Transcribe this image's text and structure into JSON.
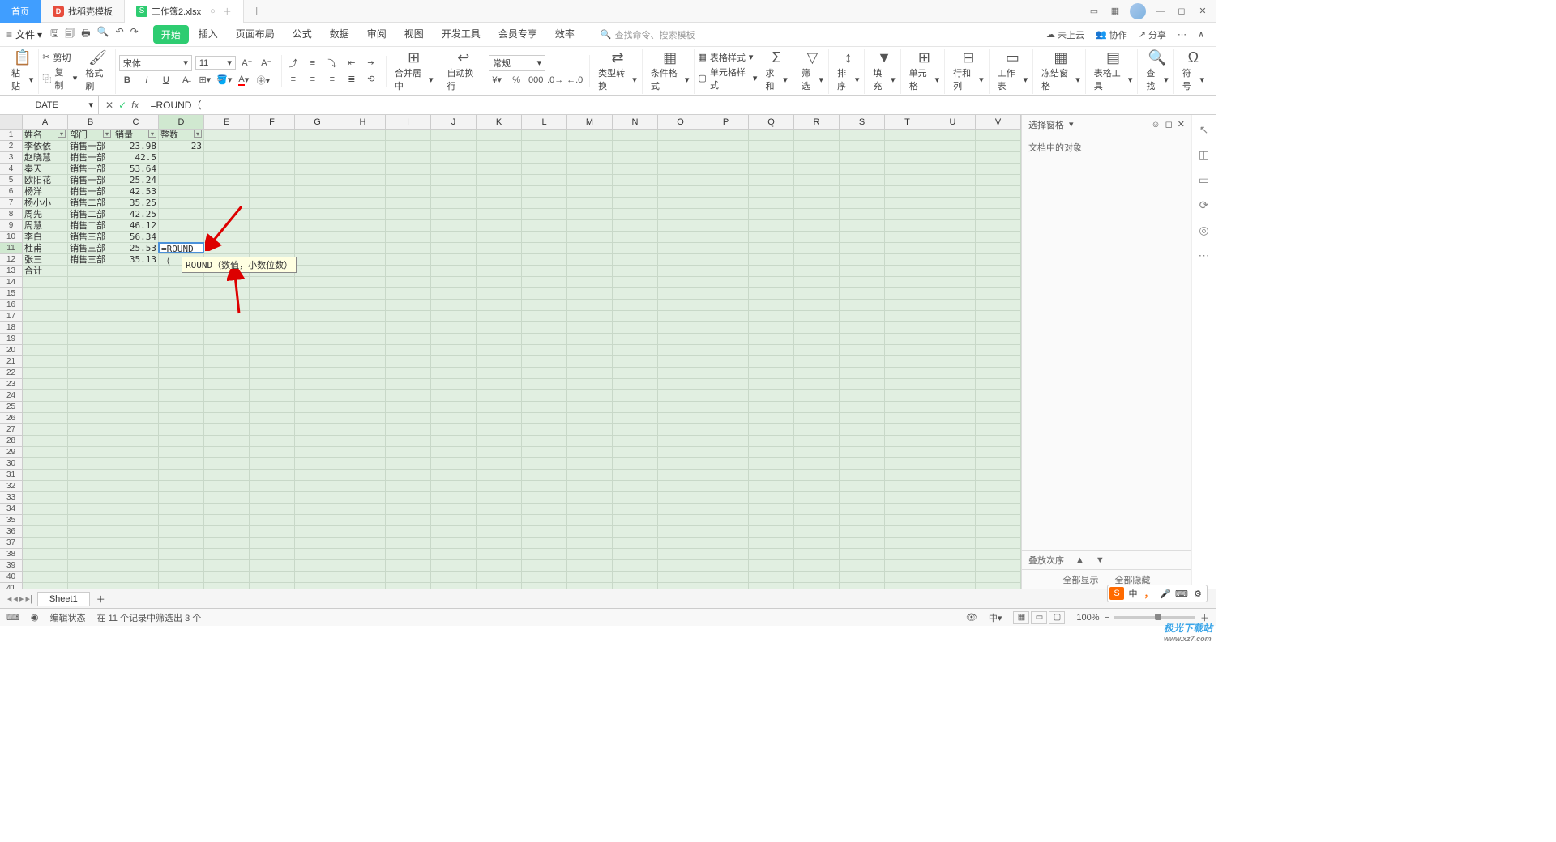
{
  "tabs": {
    "home": "首页",
    "template": "找稻壳模板",
    "workbook": "工作簿2.xlsx"
  },
  "menu": {
    "file": "文件"
  },
  "menutabs": [
    "开始",
    "插入",
    "页面布局",
    "公式",
    "数据",
    "审阅",
    "视图",
    "开发工具",
    "会员专享",
    "效率"
  ],
  "search_placeholder": "查找命令、搜索模板",
  "topright": {
    "cloud": "未上云",
    "collab": "协作",
    "share": "分享"
  },
  "ribbon": {
    "paste": "粘贴",
    "cut": "剪切",
    "copy": "复制",
    "format_painter": "格式刷",
    "font_name": "宋体",
    "font_size": "11",
    "merge": "合并居中",
    "wrap": "自动换行",
    "numfmt": "常规",
    "type_convert": "类型转换",
    "cond_fmt": "条件格式",
    "table_style": "表格样式",
    "cell_style": "单元格样式",
    "sum": "求和",
    "filter": "筛选",
    "sort": "排序",
    "fill": "填充",
    "cells": "单元格",
    "rowcol": "行和列",
    "sheet": "工作表",
    "freeze": "冻结窗格",
    "table_tools": "表格工具",
    "find": "查找",
    "symbol": "符号"
  },
  "namebox": "DATE",
  "formula": "=ROUND（",
  "columns": [
    "A",
    "B",
    "C",
    "D",
    "E",
    "F",
    "G",
    "H",
    "I",
    "J",
    "K",
    "L",
    "M",
    "N",
    "O",
    "P",
    "Q",
    "R",
    "S",
    "T",
    "U",
    "V"
  ],
  "headers": {
    "a": "姓名",
    "b": "部门",
    "c": "销量",
    "d": "整数"
  },
  "rows": [
    {
      "a": "李依依",
      "b": "销售一部",
      "c": "23.98",
      "d": "23"
    },
    {
      "a": "赵晓慧",
      "b": "销售一部",
      "c": "42.5",
      "d": ""
    },
    {
      "a": "秦天",
      "b": "销售一部",
      "c": "53.64",
      "d": ""
    },
    {
      "a": "欧阳花",
      "b": "销售一部",
      "c": "25.24",
      "d": ""
    },
    {
      "a": "杨洋",
      "b": "销售一部",
      "c": "42.53",
      "d": ""
    },
    {
      "a": "杨小小",
      "b": "销售二部",
      "c": "35.25",
      "d": ""
    },
    {
      "a": "周先",
      "b": "销售二部",
      "c": "42.25",
      "d": ""
    },
    {
      "a": "周慧",
      "b": "销售二部",
      "c": "46.12",
      "d": ""
    },
    {
      "a": "李白",
      "b": "销售三部",
      "c": "56.34",
      "d": ""
    },
    {
      "a": "杜甫",
      "b": "销售三部",
      "c": "25.53",
      "d": "=ROUND（"
    },
    {
      "a": "张三",
      "b": "销售三部",
      "c": "35.13",
      "d": ""
    },
    {
      "a": "合计",
      "b": "",
      "c": "",
      "d": ""
    }
  ],
  "tooltip_full": "ROUND（数值，小数位数）",
  "sheet": "Sheet1",
  "side": {
    "title": "选择窗格",
    "body": "文档中的对象"
  },
  "bottom": {
    "order": "叠放次序",
    "show_all": "全部显示",
    "hide_all": "全部隐藏"
  },
  "status": {
    "mode": "编辑状态",
    "selection": "在 11 个记录中筛选出 3 个",
    "zoom": "100%"
  },
  "ime": {
    "zh": "中",
    "comma": "，"
  },
  "watermark": {
    "t1": "极光下载站",
    "t2": "www.xz7.com"
  }
}
